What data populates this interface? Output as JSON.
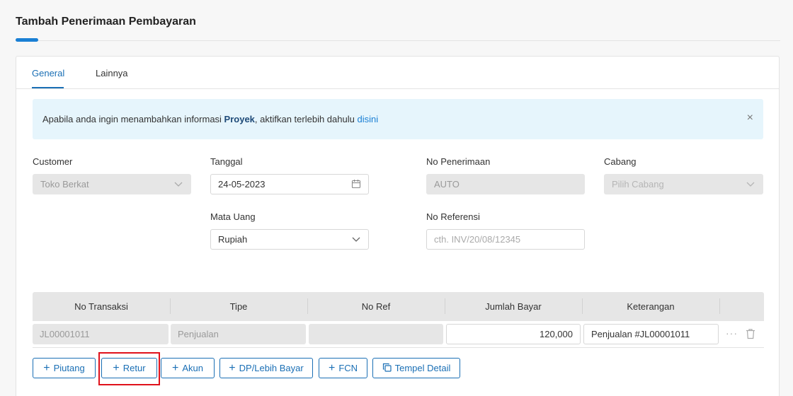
{
  "page": {
    "title": "Tambah Penerimaan Pembayaran"
  },
  "tabs": [
    {
      "label": "General",
      "active": true
    },
    {
      "label": "Lainnya",
      "active": false
    }
  ],
  "alert": {
    "text_before": "Apabila anda ingin menambahkan informasi ",
    "text_bold": "Proyek",
    "text_after": ", aktifkan terlebih dahulu ",
    "link": "disini",
    "close": "×"
  },
  "form": {
    "customer": {
      "label": "Customer",
      "value": "Toko Berkat"
    },
    "tanggal": {
      "label": "Tanggal",
      "value": "24-05-2023"
    },
    "no_penerimaan": {
      "label": "No Penerimaan",
      "value": "AUTO"
    },
    "cabang": {
      "label": "Cabang",
      "placeholder": "Pilih Cabang"
    },
    "mata_uang": {
      "label": "Mata Uang",
      "value": "Rupiah"
    },
    "no_referensi": {
      "label": "No Referensi",
      "placeholder": "cth. INV/20/08/12345"
    }
  },
  "table": {
    "columns": [
      "No Transaksi",
      "Tipe",
      "No Ref",
      "Jumlah Bayar",
      "Keterangan"
    ],
    "rows": [
      {
        "no_transaksi": "JL00001011",
        "tipe": "Penjualan",
        "no_ref": "",
        "jumlah_bayar": "120,000",
        "keterangan": "Penjualan #JL00001011",
        "more": "···"
      }
    ]
  },
  "buttons": {
    "piutang": "Piutang",
    "retur": "Retur",
    "akun": "Akun",
    "dp": "DP/Lebih Bayar",
    "fcn": "FCN",
    "tempel": "Tempel Detail",
    "plus": "+"
  },
  "colors": {
    "primary": "#1a6fb5",
    "highlight": "#e0111b",
    "alert_bg": "#e6f5fc"
  },
  "icons": {
    "calendar": "calendar-icon",
    "chevron": "chevron-down-icon",
    "trash": "trash-icon",
    "copy": "copy-icon",
    "close": "close-icon"
  }
}
